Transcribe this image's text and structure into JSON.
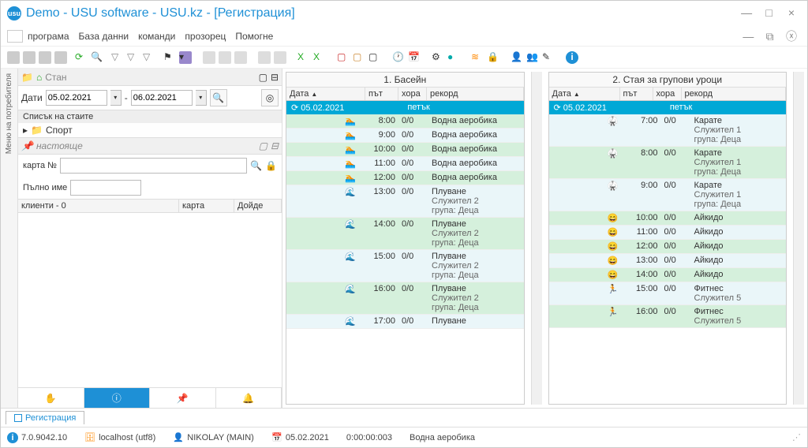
{
  "title": "Demo - USU software - USU.kz - [Регистрация]",
  "menu": {
    "items": [
      "програма",
      "База данни",
      "команди",
      "прозорец",
      "Помогне"
    ]
  },
  "sidepanel": {
    "crumb": "Стан",
    "date_label": "Дати",
    "date_from": "05.02.2021",
    "date_to": "06.02.2021",
    "rooms_header": "Списък на стаите",
    "room1": "Спорт",
    "current_label": "настояще",
    "card_label": "карта №",
    "name_label": "Пълно име",
    "clients_col1": "клиенти - 0",
    "clients_col2": "карта",
    "clients_col3": "Дойде"
  },
  "vtab": "Меню на потребителя",
  "sched1": {
    "title": "1. Басейн",
    "cols": {
      "c1": "Дата",
      "c2": "път",
      "c3": "хора",
      "c4": "рекорд"
    },
    "daterow": {
      "date": "05.02.2021",
      "dow": "петък"
    },
    "rows": [
      {
        "bg": "g",
        "ico": "🏊",
        "time": "8:00",
        "pp": "0/0",
        "rec": "Водна аеробика"
      },
      {
        "bg": "b",
        "ico": "🏊",
        "time": "9:00",
        "pp": "0/0",
        "rec": "Водна аеробика"
      },
      {
        "bg": "g",
        "ico": "🏊",
        "time": "10:00",
        "pp": "0/0",
        "rec": "Водна аеробика"
      },
      {
        "bg": "b",
        "ico": "🏊",
        "time": "11:00",
        "pp": "0/0",
        "rec": "Водна аеробика"
      },
      {
        "bg": "g",
        "ico": "🏊",
        "time": "12:00",
        "pp": "0/0",
        "rec": "Водна аеробика"
      },
      {
        "bg": "b",
        "ico": "🌊",
        "time": "13:00",
        "pp": "0/0",
        "rec": "Плуване",
        "sub": "Служител 2\nгрупа: Деца"
      },
      {
        "bg": "g",
        "ico": "🌊",
        "time": "14:00",
        "pp": "0/0",
        "rec": "Плуване",
        "sub": "Служител 2\nгрупа: Деца"
      },
      {
        "bg": "b",
        "ico": "🌊",
        "time": "15:00",
        "pp": "0/0",
        "rec": "Плуване",
        "sub": "Служител 2\nгрупа: Деца"
      },
      {
        "bg": "g",
        "ico": "🌊",
        "time": "16:00",
        "pp": "0/0",
        "rec": "Плуване",
        "sub": "Служител 2\nгрупа: Деца"
      },
      {
        "bg": "b",
        "ico": "🌊",
        "time": "17:00",
        "pp": "0/0",
        "rec": "Плуване"
      }
    ]
  },
  "sched2": {
    "title": "2. Стая за групови уроци",
    "cols": {
      "c1": "Дата",
      "c2": "път",
      "c3": "хора",
      "c4": "рекорд"
    },
    "daterow": {
      "date": "05.02.2021",
      "dow": "петък"
    },
    "rows": [
      {
        "bg": "b",
        "ico": "🥋",
        "time": "7:00",
        "pp": "0/0",
        "rec": "Карате",
        "sub": "Служител 1\nгрупа: Деца"
      },
      {
        "bg": "g",
        "ico": "🥋",
        "time": "8:00",
        "pp": "0/0",
        "rec": "Карате",
        "sub": "Служител 1\nгрупа: Деца"
      },
      {
        "bg": "b",
        "ico": "🥋",
        "time": "9:00",
        "pp": "0/0",
        "rec": "Карате",
        "sub": "Служител 1\nгрупа: Деца"
      },
      {
        "bg": "g",
        "ico": "😄",
        "time": "10:00",
        "pp": "0/0",
        "rec": "Айкидо"
      },
      {
        "bg": "b",
        "ico": "😄",
        "time": "11:00",
        "pp": "0/0",
        "rec": "Айкидо"
      },
      {
        "bg": "g",
        "ico": "😄",
        "time": "12:00",
        "pp": "0/0",
        "rec": "Айкидо"
      },
      {
        "bg": "b",
        "ico": "😄",
        "time": "13:00",
        "pp": "0/0",
        "rec": "Айкидо"
      },
      {
        "bg": "g",
        "ico": "😄",
        "time": "14:00",
        "pp": "0/0",
        "rec": "Айкидо"
      },
      {
        "bg": "b",
        "ico": "🏃",
        "time": "15:00",
        "pp": "0/0",
        "rec": "Фитнес",
        "sub": "Служител 5"
      },
      {
        "bg": "g",
        "ico": "🏃",
        "time": "16:00",
        "pp": "0/0",
        "rec": "Фитнес",
        "sub": "Служител 5"
      }
    ]
  },
  "tab": "Регистрация",
  "status": {
    "version": "7.0.9042.10",
    "host": "localhost (utf8)",
    "user": "NIKOLAY (MAIN)",
    "date": "05.02.2021",
    "time": "0:00:00:003",
    "activity": "Водна аеробика"
  }
}
